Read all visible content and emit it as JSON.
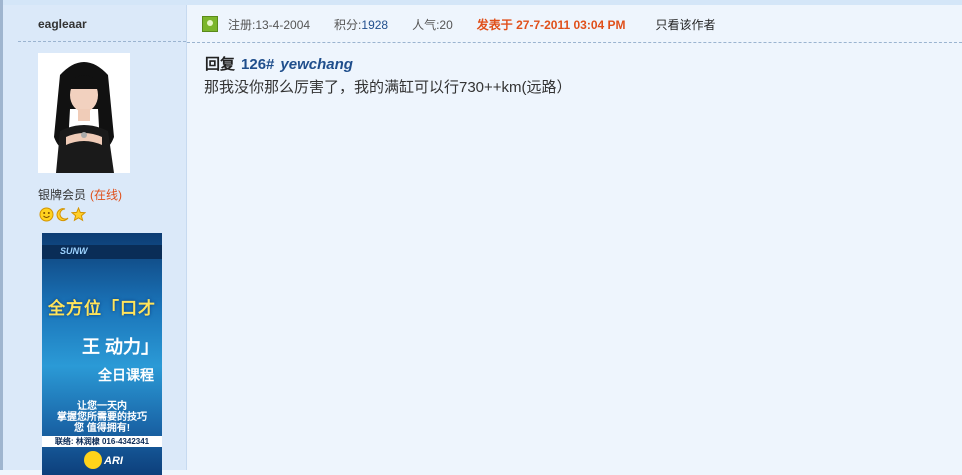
{
  "author": {
    "username": "eagleaar",
    "rank": "银牌会员",
    "status": "(在线)"
  },
  "ad": {
    "logo": "SUNW",
    "headline_vertical": "全方位「口才",
    "headline_big": "王 动力」",
    "headline_sub": "全日课程",
    "tagline_1": "让您一天内",
    "tagline_2": "掌握您所需要的技巧",
    "tagline_3": "您 值得拥有!",
    "contact": "联络: 林润棣 016-4342341",
    "brand": "ARI"
  },
  "post_meta": {
    "registered": "注册:13-4-2004",
    "points_label": "积分:",
    "points_value": "1928",
    "popularity": "人气:20",
    "posted_at": "发表于 27-7-2011 03:04 PM",
    "author_only": "只看该作者"
  },
  "reply": {
    "prefix": "回复",
    "floor": "126#",
    "reply_to": "yewchang",
    "body": "那我没你那么厉害了，我的满缸可以行730++km(远路）"
  },
  "icons": {
    "badges": [
      "smiley-icon",
      "moon-icon",
      "star-icon"
    ],
    "user-icon": "user-icon"
  },
  "colors": {
    "page_bg": "#eef5fd",
    "sidebar_bg": "#dbe9f9",
    "link_blue": "#1f4e8c",
    "accent_orange": "#e0501b"
  }
}
